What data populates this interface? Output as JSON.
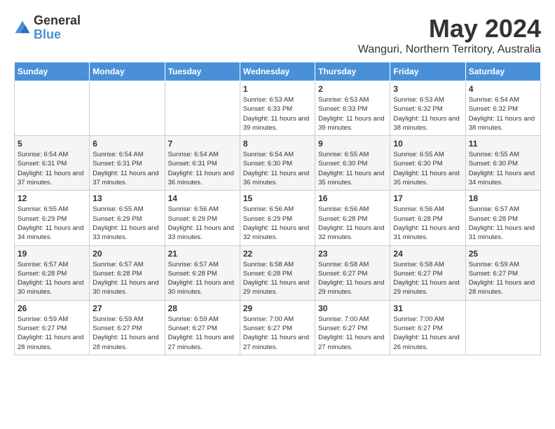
{
  "logo": {
    "general": "General",
    "blue": "Blue"
  },
  "title": "May 2024",
  "location": "Wanguri, Northern Territory, Australia",
  "weekdays": [
    "Sunday",
    "Monday",
    "Tuesday",
    "Wednesday",
    "Thursday",
    "Friday",
    "Saturday"
  ],
  "weeks": [
    [
      {
        "day": "",
        "info": ""
      },
      {
        "day": "",
        "info": ""
      },
      {
        "day": "",
        "info": ""
      },
      {
        "day": "1",
        "info": "Sunrise: 6:53 AM\nSunset: 6:33 PM\nDaylight: 11 hours and 39 minutes."
      },
      {
        "day": "2",
        "info": "Sunrise: 6:53 AM\nSunset: 6:33 PM\nDaylight: 11 hours and 39 minutes."
      },
      {
        "day": "3",
        "info": "Sunrise: 6:53 AM\nSunset: 6:32 PM\nDaylight: 11 hours and 38 minutes."
      },
      {
        "day": "4",
        "info": "Sunrise: 6:54 AM\nSunset: 6:32 PM\nDaylight: 11 hours and 38 minutes."
      }
    ],
    [
      {
        "day": "5",
        "info": "Sunrise: 6:54 AM\nSunset: 6:31 PM\nDaylight: 11 hours and 37 minutes."
      },
      {
        "day": "6",
        "info": "Sunrise: 6:54 AM\nSunset: 6:31 PM\nDaylight: 11 hours and 37 minutes."
      },
      {
        "day": "7",
        "info": "Sunrise: 6:54 AM\nSunset: 6:31 PM\nDaylight: 11 hours and 36 minutes."
      },
      {
        "day": "8",
        "info": "Sunrise: 6:54 AM\nSunset: 6:30 PM\nDaylight: 11 hours and 36 minutes."
      },
      {
        "day": "9",
        "info": "Sunrise: 6:55 AM\nSunset: 6:30 PM\nDaylight: 11 hours and 35 minutes."
      },
      {
        "day": "10",
        "info": "Sunrise: 6:55 AM\nSunset: 6:30 PM\nDaylight: 11 hours and 35 minutes."
      },
      {
        "day": "11",
        "info": "Sunrise: 6:55 AM\nSunset: 6:30 PM\nDaylight: 11 hours and 34 minutes."
      }
    ],
    [
      {
        "day": "12",
        "info": "Sunrise: 6:55 AM\nSunset: 6:29 PM\nDaylight: 11 hours and 34 minutes."
      },
      {
        "day": "13",
        "info": "Sunrise: 6:55 AM\nSunset: 6:29 PM\nDaylight: 11 hours and 33 minutes."
      },
      {
        "day": "14",
        "info": "Sunrise: 6:56 AM\nSunset: 6:29 PM\nDaylight: 11 hours and 33 minutes."
      },
      {
        "day": "15",
        "info": "Sunrise: 6:56 AM\nSunset: 6:29 PM\nDaylight: 11 hours and 32 minutes."
      },
      {
        "day": "16",
        "info": "Sunrise: 6:56 AM\nSunset: 6:28 PM\nDaylight: 11 hours and 32 minutes."
      },
      {
        "day": "17",
        "info": "Sunrise: 6:56 AM\nSunset: 6:28 PM\nDaylight: 11 hours and 31 minutes."
      },
      {
        "day": "18",
        "info": "Sunrise: 6:57 AM\nSunset: 6:28 PM\nDaylight: 11 hours and 31 minutes."
      }
    ],
    [
      {
        "day": "19",
        "info": "Sunrise: 6:57 AM\nSunset: 6:28 PM\nDaylight: 11 hours and 30 minutes."
      },
      {
        "day": "20",
        "info": "Sunrise: 6:57 AM\nSunset: 6:28 PM\nDaylight: 11 hours and 30 minutes."
      },
      {
        "day": "21",
        "info": "Sunrise: 6:57 AM\nSunset: 6:28 PM\nDaylight: 11 hours and 30 minutes."
      },
      {
        "day": "22",
        "info": "Sunrise: 6:58 AM\nSunset: 6:28 PM\nDaylight: 11 hours and 29 minutes."
      },
      {
        "day": "23",
        "info": "Sunrise: 6:58 AM\nSunset: 6:27 PM\nDaylight: 11 hours and 29 minutes."
      },
      {
        "day": "24",
        "info": "Sunrise: 6:58 AM\nSunset: 6:27 PM\nDaylight: 11 hours and 29 minutes."
      },
      {
        "day": "25",
        "info": "Sunrise: 6:59 AM\nSunset: 6:27 PM\nDaylight: 11 hours and 28 minutes."
      }
    ],
    [
      {
        "day": "26",
        "info": "Sunrise: 6:59 AM\nSunset: 6:27 PM\nDaylight: 11 hours and 28 minutes."
      },
      {
        "day": "27",
        "info": "Sunrise: 6:59 AM\nSunset: 6:27 PM\nDaylight: 11 hours and 28 minutes."
      },
      {
        "day": "28",
        "info": "Sunrise: 6:59 AM\nSunset: 6:27 PM\nDaylight: 11 hours and 27 minutes."
      },
      {
        "day": "29",
        "info": "Sunrise: 7:00 AM\nSunset: 6:27 PM\nDaylight: 11 hours and 27 minutes."
      },
      {
        "day": "30",
        "info": "Sunrise: 7:00 AM\nSunset: 6:27 PM\nDaylight: 11 hours and 27 minutes."
      },
      {
        "day": "31",
        "info": "Sunrise: 7:00 AM\nSunset: 6:27 PM\nDaylight: 11 hours and 26 minutes."
      },
      {
        "day": "",
        "info": ""
      }
    ]
  ]
}
